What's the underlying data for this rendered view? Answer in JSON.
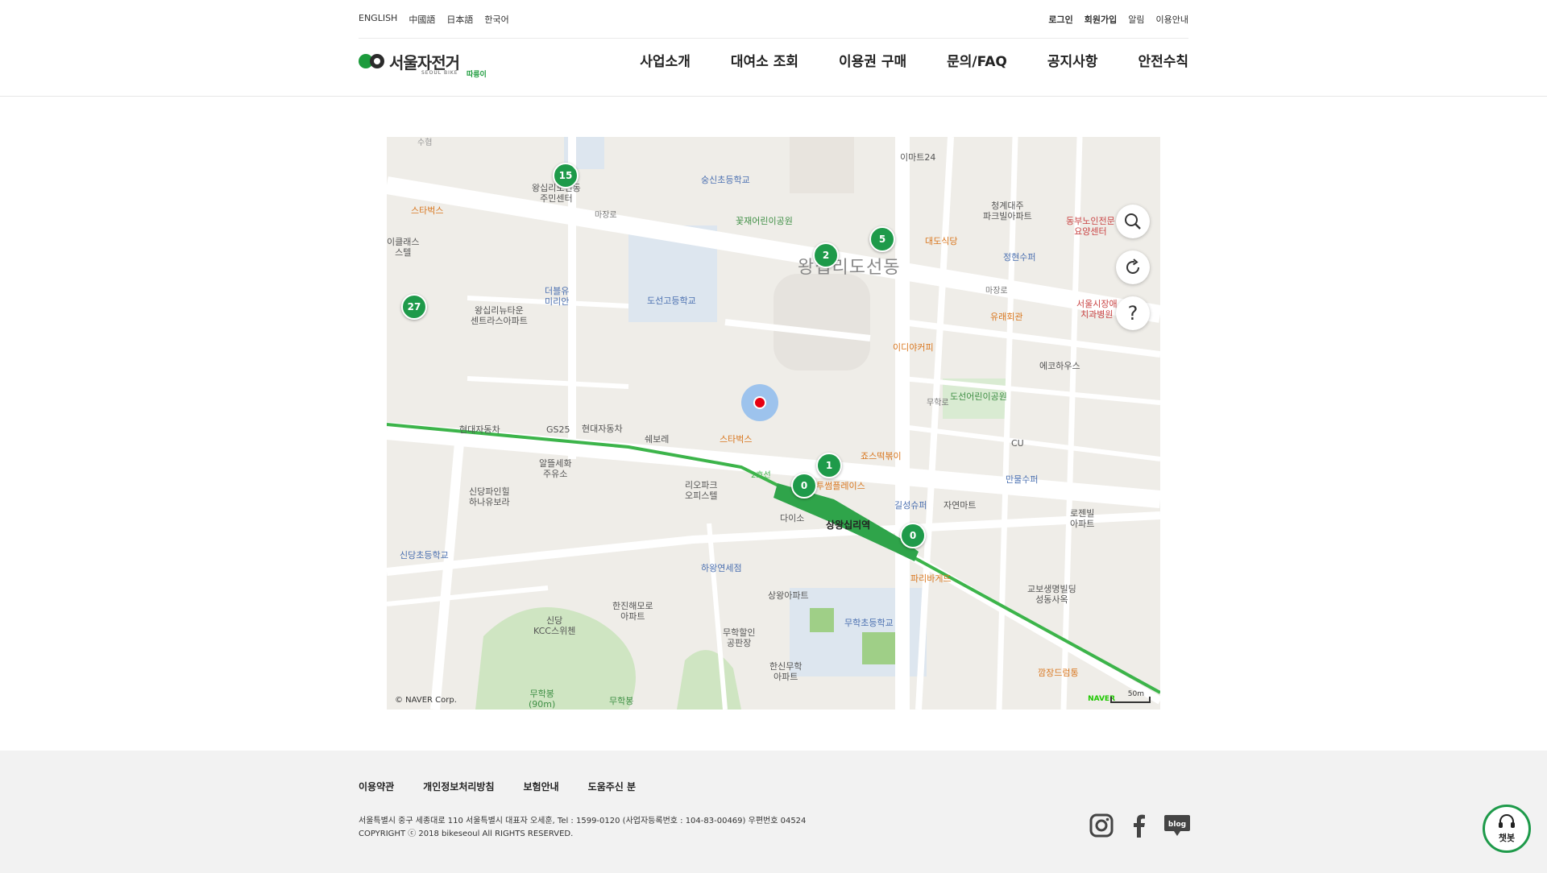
{
  "header": {
    "languages": [
      "ENGLISH",
      "中國語",
      "日本語",
      "한국어"
    ],
    "util_links": [
      "로그인",
      "회원가입",
      "알림",
      "이용안내"
    ],
    "logo": {
      "ko": "서울자전거",
      "en": "SEOUL BIKE",
      "brand": "따릉이"
    },
    "nav": [
      "사업소개",
      "대여소 조회",
      "이용권 구매",
      "문의/FAQ",
      "공지사항",
      "안전수칙"
    ]
  },
  "map": {
    "clusters": [
      {
        "count": "15"
      },
      {
        "count": "2"
      },
      {
        "count": "5"
      },
      {
        "count": "27"
      },
      {
        "count": "1"
      },
      {
        "count": "0"
      },
      {
        "count": "0"
      }
    ],
    "area_name": "왕십리도선동",
    "station_name": "상왕십리역",
    "labels": {
      "suhyup": "수협",
      "sungshin": "숭신초등학교",
      "wangsimni_center": "왕십리도선동\n주민센터",
      "starbucks1": "스타벅스",
      "kkotjae": "꽃재어린이공원",
      "emart24": "이마트24",
      "cheonggye": "청계대주\n파크빌아파트",
      "dongbu": "동부노인전문\n요양센터",
      "daedo": "대도식당",
      "jeongdeok": "정현수퍼",
      "theplus": "더블유\n미리안",
      "doseon_high": "도선고등학교",
      "wangsimni_newtown": "왕십리뉴타운\n센트라스아파트",
      "yurae": "유래회관",
      "seoul_clinic": "서울시장애\n치과병원",
      "idiya": "이디야커피",
      "ecohouse": "에코하우스",
      "doseon_park": "도선어린이공원",
      "hyundai1": "현대자동차",
      "gs25": "GS25",
      "hyundai2": "현대자동차",
      "shebore": "쉐보레",
      "starbucks2": "스타벅스",
      "jjos": "죠스떡볶이",
      "cu": "CU",
      "manmul": "만물수퍼",
      "almtle": "알뜰세화\n주유소",
      "sindang_ind": "신당파인힐\n하나유보라",
      "riopark": "리오파크\n오피스텔",
      "twosome": "투썸플레이스",
      "daiso": "다이소",
      "kilsung": "길성슈퍼",
      "jayeon": "자연마트",
      "rojen": "로젠빌\n아파트",
      "sindang_elem": "신당초등학교",
      "hawang": "하왕연세점",
      "paris": "파리바게뜨",
      "kyobo": "교보생명빌딩\n성동사옥",
      "hanjin": "한진해모로\n아파트",
      "sangwang_apt": "상왕아파트",
      "muhak_elem": "무학초등학교",
      "sindang_kcc": "신당\nKCC스위첸",
      "muhak_market": "무학할인\n공판장",
      "hanshin": "한신무학\n아파트",
      "kkang": "깜장드럼통",
      "muhakbong": "무학봉\n(90m)",
      "muhakbong2": "무학봉",
      "line2": "2호선",
      "road_majang": "마장로",
      "road_muhak": "무학로",
      "sbucks_left": "이클래스\n스텔"
    },
    "copyright": "© NAVER Corp.",
    "logo": "NAVER",
    "scale": "50m",
    "controls": [
      "search-icon",
      "refresh-icon",
      "help-icon"
    ]
  },
  "footer": {
    "links": [
      "이용약관",
      "개인정보처리방침",
      "보험안내",
      "도움주신 분"
    ],
    "address": "서울특별시 중구 세종대로 110 서울특별시 대표자 오세훈, Tel : 1599-0120 (사업자등록번호 : 104-83-00469) 우편번호 04524",
    "copyright": "COPYRIGHT ⓒ 2018 bikeseoul All RIGHTS RESERVED.",
    "sns": [
      "instagram-icon",
      "facebook-icon",
      "blog-icon"
    ]
  },
  "chatbot": {
    "label": "챗봇"
  },
  "colors": {
    "accent": "#1e9a4a",
    "subway": "#3cb44a",
    "location": "#e60012"
  }
}
